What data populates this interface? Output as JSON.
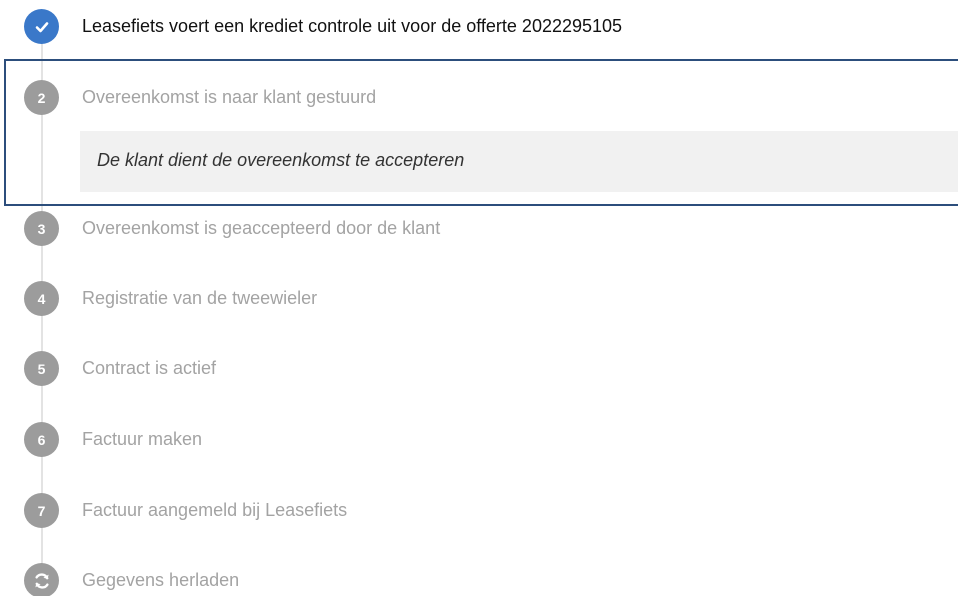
{
  "colors": {
    "accent": "#3a78c9",
    "highlight_border": "#2c4e7c",
    "badge_inactive": "#9c9c9c",
    "label_inactive": "#a3a3a3",
    "detail_background": "#f1f1f1"
  },
  "steps": [
    {
      "badge": "",
      "icon": "check-icon",
      "status": "done",
      "label": "Leasefiets voert een krediet controle uit voor de offerte 2022295105"
    },
    {
      "badge": "2",
      "status": "current",
      "label": "Overeenkomst is naar klant gestuurd",
      "detail": "De klant dient de overeenkomst te accepteren"
    },
    {
      "badge": "3",
      "status": "pending",
      "label": "Overeenkomst is geaccepteerd door de klant"
    },
    {
      "badge": "4",
      "status": "pending",
      "label": "Registratie van de tweewieler"
    },
    {
      "badge": "5",
      "status": "pending",
      "label": "Contract is actief"
    },
    {
      "badge": "6",
      "status": "pending",
      "label": "Factuur maken"
    },
    {
      "badge": "7",
      "status": "pending",
      "label": "Factuur aangemeld bij Leasefiets"
    }
  ],
  "reload": {
    "icon": "refresh-icon",
    "label": "Gegevens herladen"
  }
}
